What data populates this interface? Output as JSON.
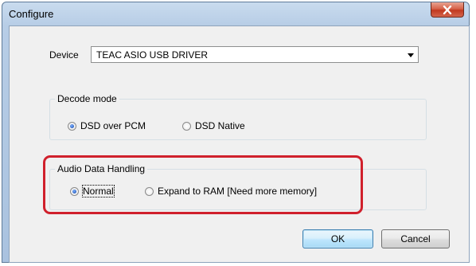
{
  "window": {
    "title": "Configure"
  },
  "device": {
    "label": "Device",
    "selected": "TEAC ASIO USB DRIVER"
  },
  "decode_mode": {
    "title": "Decode mode",
    "options": [
      {
        "label": "DSD over PCM",
        "selected": true
      },
      {
        "label": "DSD Native",
        "selected": false
      }
    ]
  },
  "audio_data_handling": {
    "title": "Audio Data Handling",
    "options": [
      {
        "label": "Normal",
        "selected": true
      },
      {
        "label": "Expand to RAM [Need more memory]",
        "selected": false
      }
    ]
  },
  "buttons": {
    "ok": "OK",
    "cancel": "Cancel"
  },
  "colors": {
    "highlight_border": "#d0202c",
    "close_button": "#c1391f"
  }
}
